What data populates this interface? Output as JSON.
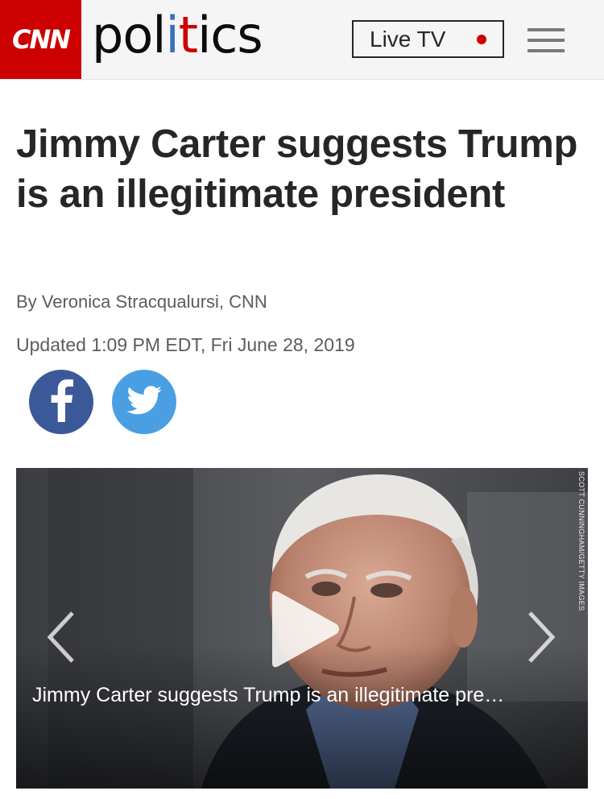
{
  "header": {
    "brand": "CNN",
    "section_parts": [
      "pol",
      "i",
      "t",
      "ics"
    ],
    "live_tv_label": "Live TV",
    "colors": {
      "brand_red": "#cc0000",
      "header_bg": "#f5f5f5"
    }
  },
  "article": {
    "headline": "Jimmy Carter suggests Trump is an illegitimate president",
    "byline": "By Veronica Stracqualursi, CNN",
    "updated": "Updated 1:09 PM EDT, Fri June 28, 2019"
  },
  "share": {
    "facebook_icon": "facebook-icon",
    "twitter_icon": "twitter-icon",
    "facebook_color": "#3b5998",
    "twitter_color": "#4a9fe3"
  },
  "media": {
    "credit": "SCOTT CUNNINGHAM/GETTY IMAGES",
    "caption": "Jimmy Carter suggests Trump is an illegitimate pre…",
    "icons": [
      "play-icon",
      "chevron-left-icon",
      "chevron-right-icon"
    ]
  }
}
